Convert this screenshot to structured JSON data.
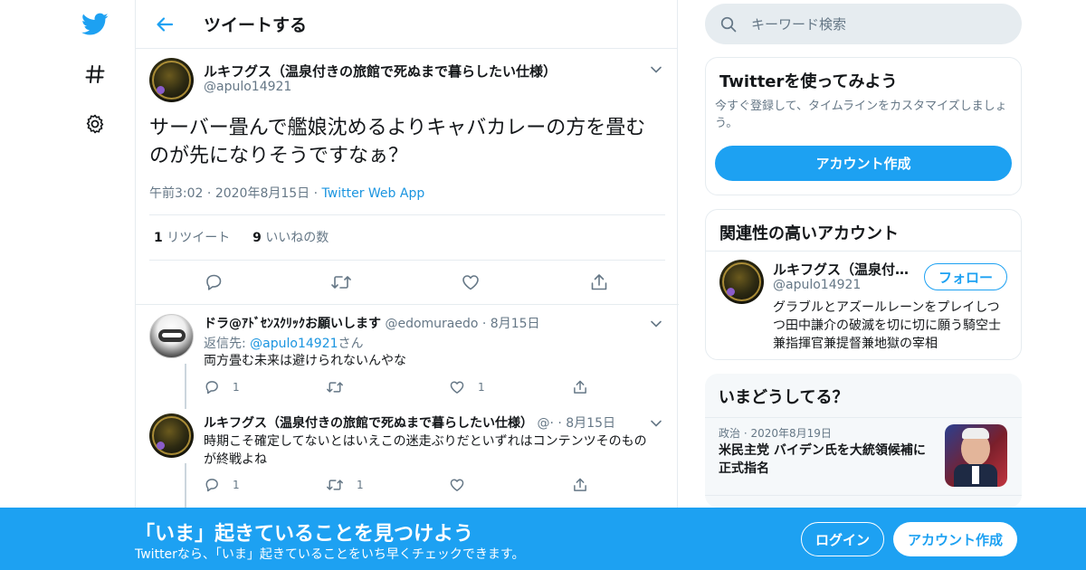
{
  "colors": {
    "accent": "#1da1f2",
    "text": "#14171a",
    "muted": "#657786",
    "border": "#e6ecf0"
  },
  "nav": {
    "icons": [
      "twitter-logo-icon",
      "hashtag-icon",
      "gear-icon"
    ]
  },
  "header": {
    "title": "ツイートする"
  },
  "main_tweet": {
    "name": "ルキフグス（温泉付きの旅館で死ぬまで暮らしたい仕様）",
    "handle": "@apulo14921",
    "text": "サーバー畳んで艦娘沈めるよりキャバカレーの方を畳むのが先になりそうですなぁ？",
    "time": "午前3:02",
    "date": "2020年8月15日",
    "source": "Twitter Web App",
    "retweet_count": "1",
    "retweet_label": "リツイート",
    "like_count": "9",
    "like_label": "いいねの数"
  },
  "replies": [
    {
      "name": "ドラ@ｱﾄﾞｾﾝｽｸﾘｯｸお願いします",
      "handle": "@edomuraedo",
      "date": "8月15日",
      "reply_to_prefix": "返信先: ",
      "reply_to_handle": "@apulo14921",
      "reply_to_suffix": "さん",
      "text": "両方畳む未来は避けられないんやな",
      "reply_count": "1",
      "retweet_count": "",
      "like_count": "1"
    },
    {
      "name": "ルキフグス（温泉付きの旅館で死ぬまで暮らしたい仕様）",
      "handle": "@·",
      "date": "8月15日",
      "text": "時期こそ確定してないとはいえこの迷走ぶりだといずれはコンテンツそのものが終戦よね",
      "reply_count": "1",
      "retweet_count": "1",
      "like_count": ""
    }
  ],
  "search": {
    "placeholder": "キーワード検索"
  },
  "signup_card": {
    "title": "Twitterを使ってみよう",
    "text": "今すぐ登録して、タイムラインをカスタマイズしましょう。",
    "button": "アカウント作成"
  },
  "related_card": {
    "title": "関連性の高いアカウント",
    "name": "ルキフグス（温泉付…",
    "handle": "@apulo14921",
    "follow": "フォロー",
    "bio": "グラブルとアズールレーンをプレイしつつ田中謙介の破滅を切に切に願う騎空士兼指揮官兼提督兼地獄の宰相"
  },
  "trends_card": {
    "title": "いまどうしてる？",
    "category": "政治",
    "date": "2020年8月19日",
    "headline": "米民主党 バイデン氏を大統領候補に正式指名"
  },
  "banner": {
    "title": "「いま」起きていることを見つけよう",
    "subtitle": "Twitterなら、「いま」起きていることをいち早くチェックできます。",
    "login": "ログイン",
    "signup": "アカウント作成"
  }
}
